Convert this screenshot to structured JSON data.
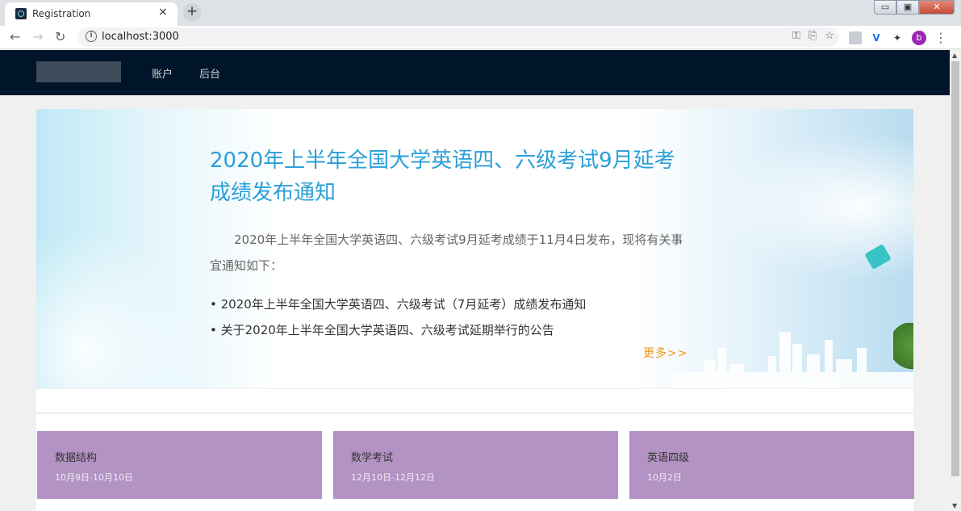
{
  "browser": {
    "tab_title": "Registration",
    "tab_close": "×",
    "new_tab": "+",
    "url": "localhost:3000",
    "info": "i",
    "avatar_letter": "b"
  },
  "window_controls": {
    "minimize": "▭",
    "maximize": "▣",
    "close": "✕"
  },
  "navbar": {
    "items": [
      {
        "label": "账户"
      },
      {
        "label": "后台"
      }
    ]
  },
  "banner": {
    "title": "2020年上半年全国大学英语四、六级考试9月延考成绩发布通知",
    "intro": "2020年上半年全国大学英语四、六级考试9月延考成绩于11月4日发布，现将有关事宜通知如下：",
    "links": [
      "2020年上半年全国大学英语四、六级考试（7月延考）成绩发布通知",
      "关于2020年上半年全国大学英语四、六级考试延期举行的公告"
    ],
    "more": "更多>>"
  },
  "cards": [
    {
      "title": "数据结构",
      "date": "10月9日-10月10日"
    },
    {
      "title": "数学考试",
      "date": "12月10日-12月12日"
    },
    {
      "title": "英语四级",
      "date": "10月2日"
    }
  ],
  "colors": {
    "nav_bg": "#001529",
    "title_blue": "#2a9fd8",
    "more_orange": "#f29418",
    "card_purple": "#b293c3"
  }
}
